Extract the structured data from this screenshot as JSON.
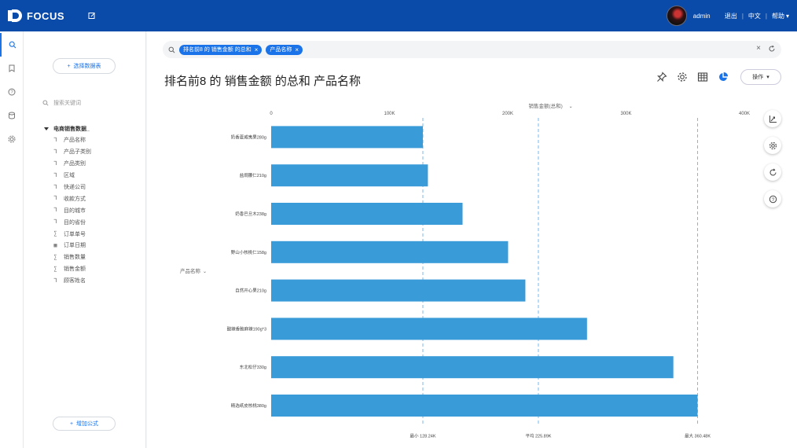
{
  "app": {
    "name": "FOCUS"
  },
  "topbar": {
    "user": "admin",
    "logout": "退出",
    "lang": "中文",
    "help": "帮助"
  },
  "panel": {
    "select_table": "选择数据表",
    "search_placeholder": "搜索关键词",
    "tree_root": "电商销售数据_",
    "fields": [
      {
        "label": "产品名称",
        "type": "text"
      },
      {
        "label": "产品子类别",
        "type": "text"
      },
      {
        "label": "产品类别",
        "type": "text"
      },
      {
        "label": "区域",
        "type": "text"
      },
      {
        "label": "快递公司",
        "type": "text"
      },
      {
        "label": "收款方式",
        "type": "text"
      },
      {
        "label": "目的城市",
        "type": "text"
      },
      {
        "label": "目的省份",
        "type": "text"
      },
      {
        "label": "订单单号",
        "type": "number"
      },
      {
        "label": "订单日期",
        "type": "date"
      },
      {
        "label": "销售数量",
        "type": "number"
      },
      {
        "label": "销售金额",
        "type": "number"
      },
      {
        "label": "顾客姓名",
        "type": "text"
      }
    ],
    "add_formula": "增加公式"
  },
  "query": {
    "chips": [
      "排名前8 的 销售金额 的总和",
      "产品名称"
    ]
  },
  "main": {
    "title": "排名前8 的 销售金额 的总和 产品名称",
    "ops_label": "操作"
  },
  "colors": {
    "bar": "#3a9bd9",
    "accent": "#1a73e8",
    "topbar": "#0a4aa8"
  },
  "chart_data": {
    "type": "bar",
    "orientation": "horizontal",
    "xlabel": "销售金额(总和)",
    "ylabel": "产品名称",
    "xlim": [
      0,
      400000
    ],
    "xticks": [
      {
        "value": 0,
        "label": "0"
      },
      {
        "value": 100000,
        "label": "100K"
      },
      {
        "value": 200000,
        "label": "200K"
      },
      {
        "value": 300000,
        "label": "300K"
      },
      {
        "value": 400000,
        "label": "400K"
      }
    ],
    "categories": [
      "奶香夏威夷果280g",
      "盐焗腰仁210g",
      "奶香巴旦木238g",
      "野山小核桃仁158g",
      "自然开心果210g",
      "酸辣香脆麻辣190g*3",
      "东北松仔330g",
      "精选纸皮核桃380g"
    ],
    "values": [
      128240,
      132500,
      161800,
      200300,
      214900,
      267000,
      340000,
      360480
    ],
    "reference_lines": [
      {
        "value": 128240,
        "label": "最小 128.24K"
      },
      {
        "value": 225890,
        "label": "平均 225.89K"
      },
      {
        "value": 360480,
        "label": "最大 360.48K"
      }
    ]
  }
}
